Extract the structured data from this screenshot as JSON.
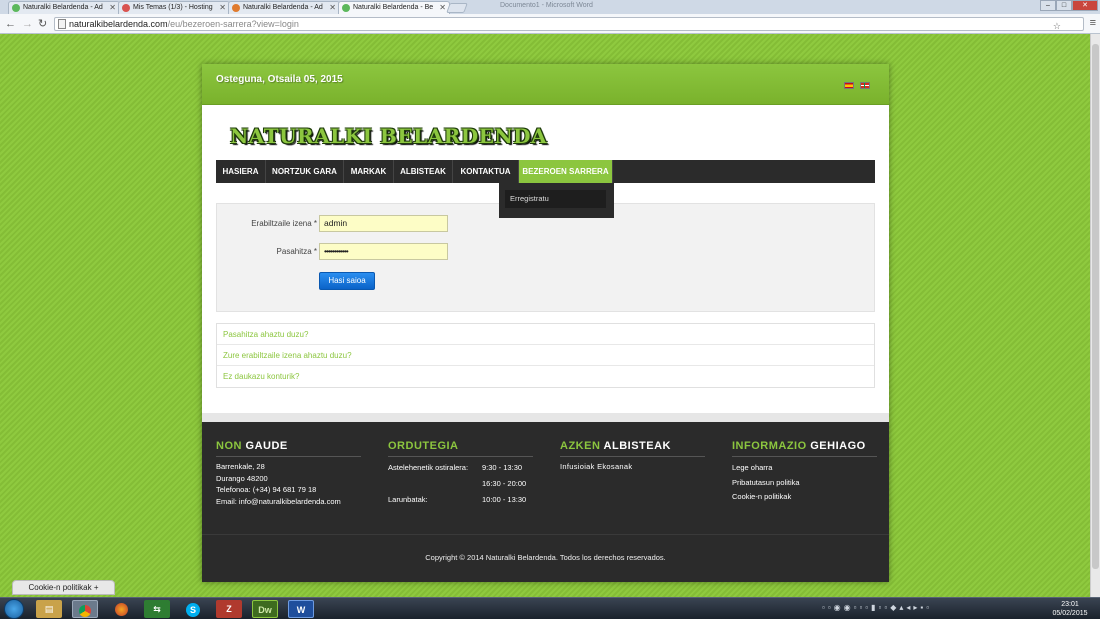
{
  "browser": {
    "tabs": [
      {
        "title": "Naturalki Belardenda - Ad",
        "active": false
      },
      {
        "title": "Mis Temas (1/3) - Hosting",
        "active": false
      },
      {
        "title": "Naturalki Belardenda - Ad",
        "active": false
      },
      {
        "title": "Naturalki Belardenda - Be",
        "active": true
      }
    ],
    "background_window_title": "Documento1 - Microsoft Word",
    "url_host": "naturalkibelardenda.com",
    "url_path": "/eu/bezeroen-sarrera?view=login"
  },
  "header": {
    "date": "Osteguna, Otsaila 05, 2015",
    "logo_text": "NATURALKI BELARDENDA"
  },
  "nav": {
    "items": [
      "HASIERA",
      "NORTZUK GARA",
      "MARKAK",
      "ALBISTEAK",
      "KONTAKTUA",
      "BEZEROEN SARRERA"
    ],
    "dropdown_item": "Erregistratu"
  },
  "login": {
    "username_label": "Erabiltzaile izena *",
    "username_value": "admin",
    "password_label": "Pasahitza *",
    "password_value": "••••••••••••",
    "submit_label": "Hasi saioa"
  },
  "links": [
    "Pasahitza ahaztu duzu?",
    "Zure erabiltzaile izena ahaztu duzu?",
    "Ez daukazu konturik?"
  ],
  "footer": {
    "col1": {
      "title_hl": "NON",
      "title": "GAUDE",
      "lines": [
        "Barrenkale, 28",
        "Durango 48200",
        "Telefonoa: (+34) 94 681 79 18",
        "Email: info@naturalkibelardenda.com"
      ]
    },
    "col2": {
      "title_hl": "ORDUTEGIA",
      "title": "",
      "rows": [
        {
          "k": "Astelehenetik ostiralera:",
          "v": "9:30 - 13:30"
        },
        {
          "k": "",
          "v": "16:30 - 20:00"
        },
        {
          "k": "Larunbatak:",
          "v": "10:00 - 13:30"
        }
      ]
    },
    "col3": {
      "title_hl": "AZKEN",
      "title": "ALBISTEAK",
      "news": "Infusioiak Ekosanak"
    },
    "col4": {
      "title_hl": "INFORMAZIO",
      "title": "GEHIAGO",
      "links": [
        "Lege oharra",
        "Pribatutasun politika",
        "Cookie-n politikak"
      ]
    },
    "copyright": "Copyright © 2014 Naturalki Belardenda. Todos los derechos reservados."
  },
  "cookie_bar": "Cookie-n politikak +",
  "taskbar": {
    "clock_time": "23:01",
    "clock_date": "05/02/2015",
    "apps": [
      "explorer",
      "chrome",
      "firefox",
      "network",
      "skype",
      "filezilla",
      "Dw",
      "W"
    ]
  },
  "colors": {
    "accent_green": "#8cc63f",
    "dark_nav": "#2b2b2b",
    "button_blue": "#0b63c8",
    "input_yellow": "#fdfdc6"
  }
}
